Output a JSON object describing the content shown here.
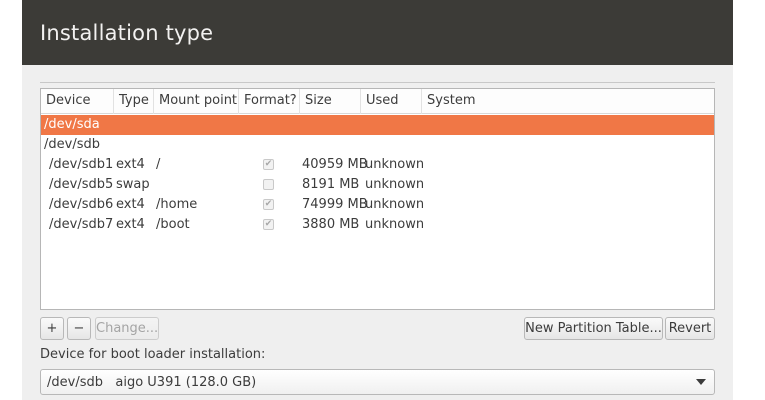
{
  "window": {
    "title": "Installation type"
  },
  "table": {
    "columns": [
      "Device",
      "Type",
      "Mount point",
      "Format?",
      "Size",
      "Used",
      "System"
    ],
    "rows": [
      {
        "device": "/dev/sda",
        "type": "",
        "mount": "",
        "format": null,
        "size": "",
        "used": "",
        "system": "",
        "selected": true
      },
      {
        "device": "/dev/sdb",
        "type": "",
        "mount": "",
        "format": null,
        "size": "",
        "used": "",
        "system": "",
        "selected": false
      },
      {
        "device": "/dev/sdb1",
        "type": "ext4",
        "mount": "/",
        "format": true,
        "size": "40959 MB",
        "used": "unknown",
        "system": "",
        "selected": false
      },
      {
        "device": "/dev/sdb5",
        "type": "swap",
        "mount": "",
        "format": false,
        "size": "8191 MB",
        "used": "unknown",
        "system": "",
        "selected": false
      },
      {
        "device": "/dev/sdb6",
        "type": "ext4",
        "mount": "/home",
        "format": true,
        "size": "74999 MB",
        "used": "unknown",
        "system": "",
        "selected": false
      },
      {
        "device": "/dev/sdb7",
        "type": "ext4",
        "mount": "/boot",
        "format": true,
        "size": "3880 MB",
        "used": "unknown",
        "system": "",
        "selected": false
      }
    ]
  },
  "toolbar": {
    "add_label": "+",
    "remove_label": "−",
    "change_label": "Change...",
    "new_table_label": "New Partition Table...",
    "revert_label": "Revert"
  },
  "bootloader": {
    "label": "Device for boot loader installation:",
    "value": "/dev/sdb   aigo U391 (128.0 GB)"
  },
  "colors": {
    "title_bar": "#3c3b37",
    "selection": "#f07746",
    "window_bg": "#efefef"
  }
}
